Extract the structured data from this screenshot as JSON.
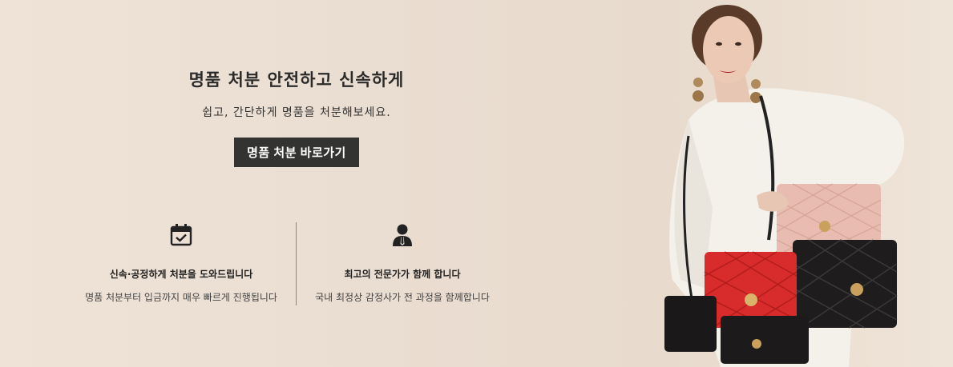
{
  "hero": {
    "headline": "명품 처분 안전하고 신속하게",
    "subline": "쉽고, 간단하게 명품을 처분해보세요.",
    "cta_label": "명품 처분 바로가기"
  },
  "features": [
    {
      "icon": "calendar-check-icon",
      "title": "신속·공정하게 처분을 도와드립니다",
      "desc": "명품 처분부터 입금까지 매우 빠르게 진행됩니다"
    },
    {
      "icon": "expert-person-icon",
      "title": "최고의 전문가가 함께 합니다",
      "desc": "국내 최정상 감정사가 전 과정을 함께합니다"
    }
  ],
  "colors": {
    "background": "#eaddd1",
    "cta_background": "#333331",
    "text_dark": "#222222"
  }
}
